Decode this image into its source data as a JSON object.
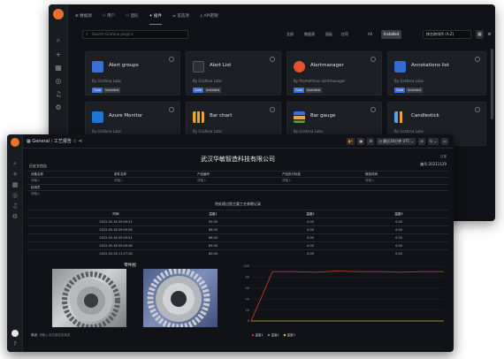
{
  "plugins_window": {
    "tabs": [
      "数据源",
      "用户",
      "团队",
      "插件",
      "首选项",
      "API密钥"
    ],
    "active_tab": 3,
    "search": {
      "placeholder": "Search Grafana plugins"
    },
    "filters": [
      "全部",
      "数据源",
      "面板",
      "应用"
    ],
    "filters2": [
      "All",
      "Installed"
    ],
    "active_filter2": 1,
    "sort": "按名称排序 (A-Z)",
    "cards": [
      {
        "name": "Alert groups",
        "by": "By Grafana Labs",
        "badges": [
          "Core",
          "Installed"
        ],
        "icon_color": "#3a6fd8"
      },
      {
        "name": "Alert List",
        "by": "By Grafana Labs",
        "badges": [
          "Core",
          "Installed"
        ],
        "icon_color": "#2b2f36"
      },
      {
        "name": "Alertmanager",
        "by": "By Prometheus alertmanager",
        "badges": [
          "Core",
          "Installed"
        ],
        "icon_color": "#e5512b"
      },
      {
        "name": "Annotations list",
        "by": "By Grafana Labs",
        "badges": [
          "Core",
          "Installed"
        ],
        "icon_color": "#2f6bd6"
      },
      {
        "name": "Azure Monitor",
        "by": "By Grafana Labs",
        "badges": [],
        "icon_color": "#1f73d1"
      },
      {
        "name": "Bar chart",
        "by": "By Grafana Labs",
        "badges": [],
        "icon_color": "#e8a33a"
      },
      {
        "name": "Bar gauge",
        "by": "By Grafana Labs",
        "badges": [],
        "icon_color": "#3a6fd8"
      },
      {
        "name": "Candlestick",
        "by": "By Grafana Labs",
        "badges": [],
        "icon_color": "#5aa0e8"
      }
    ]
  },
  "dashboard_window": {
    "breadcrumb": {
      "folder": "General",
      "title": "工艺报告"
    },
    "time_picker": "最近30分钟 UTC",
    "report": {
      "company": "武汉华敏智造科技有限公司",
      "tag": "日报",
      "serial_label": "编号:20211129",
      "left_label": "历史文档告",
      "fields_row1": [
        {
          "label": "设备名称",
          "value": "请输入"
        },
        {
          "label": "部件名称",
          "value": "请输入"
        },
        {
          "label": "产品编号",
          "value": "请输入"
        },
        {
          "label": "产品执行标准",
          "value": "请输入"
        },
        {
          "label": "报检时间",
          "value": "请输入"
        }
      ],
      "fields_row2": [
        {
          "label": "检测员",
          "value": "请输入"
        }
      ],
      "table_caption": "热处理过程主要工艺参数记录",
      "columns": [
        "时间",
        "温度1",
        "温度2",
        "温度3"
      ],
      "rows": [
        [
          "2022-05-18 05:09:51",
          "99.00",
          "0.00",
          "0.00"
        ],
        [
          "2022-05-18 05:09:56",
          "86.00",
          "0.00",
          "0.00"
        ],
        [
          "2022-05-18 05:09:51",
          "86.00",
          "0.00",
          "0.00"
        ],
        [
          "2022-05-18 05:09:46",
          "83.00",
          "0.00",
          "0.00"
        ],
        [
          "2022-05-18 11:27:28",
          "80.00",
          "0.00",
          "0.00"
        ]
      ]
    },
    "image_panel": {
      "title": "零件图",
      "remark_label": "简述:",
      "remark_value": "请输入本次报告的简述"
    },
    "chart_panel": {
      "chart_data": {
        "type": "line",
        "title": "",
        "xlabel": "",
        "ylabel": "",
        "x": [
          "",
          "",
          "",
          "",
          "",
          ""
        ],
        "ylim": [
          0,
          100
        ],
        "y_ticks": [
          "100",
          "80",
          "60",
          "40",
          "20",
          "0"
        ],
        "series": [
          {
            "name": "温度1",
            "color": "#c0392b",
            "values": [
              0,
              90,
              90,
              89,
              91,
              90,
              90,
              89,
              90,
              90
            ]
          },
          {
            "name": "温度2",
            "color": "#56a64b",
            "values": [
              0,
              0,
              0,
              0,
              0,
              0,
              0,
              0,
              0,
              0
            ]
          },
          {
            "name": "温度3",
            "color": "#f2cc0c",
            "values": [
              0,
              0,
              0,
              0,
              0,
              0,
              0,
              0,
              0,
              0
            ]
          }
        ]
      }
    }
  }
}
